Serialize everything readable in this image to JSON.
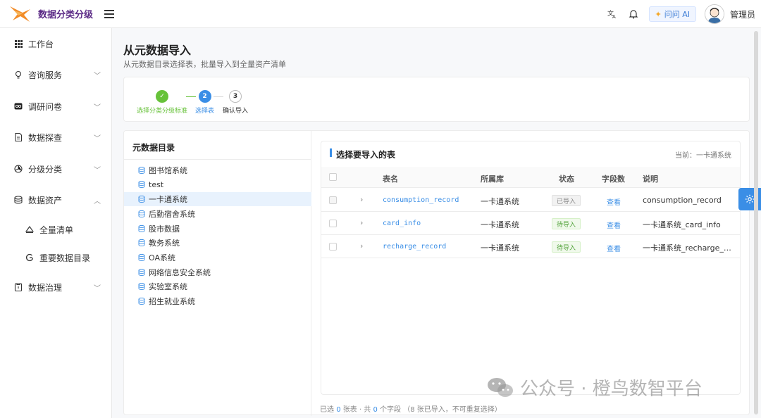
{
  "app": {
    "title": "数据分类分级"
  },
  "topbar": {
    "ai_label": "问问 AI",
    "user_name": "管理员"
  },
  "sidebar": {
    "items": [
      {
        "label": "工作台"
      },
      {
        "label": "咨询服务"
      },
      {
        "label": "调研问卷"
      },
      {
        "label": "数据探查"
      },
      {
        "label": "分级分类"
      },
      {
        "label": "数据资产"
      },
      {
        "label": "全量清单"
      },
      {
        "label": "重要数据目录"
      },
      {
        "label": "数据治理"
      }
    ]
  },
  "page": {
    "title": "从元数据导入",
    "subtitle": "从元数据目录选择表，批量导入到全量资产清单"
  },
  "steps": [
    {
      "label": "选择分类分级标准",
      "number": "✓",
      "state": "done"
    },
    {
      "label": "选择表",
      "number": "2",
      "state": "active"
    },
    {
      "label": "确认导入",
      "number": "3",
      "state": "pending"
    }
  ],
  "catalog": {
    "title": "元数据目录",
    "items": [
      {
        "label": "图书馆系统"
      },
      {
        "label": "test"
      },
      {
        "label": "一卡通系统"
      },
      {
        "label": "后勤宿舍系统"
      },
      {
        "label": "股市数据"
      },
      {
        "label": "教务系统"
      },
      {
        "label": "OA系统"
      },
      {
        "label": "网络信息安全系统"
      },
      {
        "label": "实验室系统"
      },
      {
        "label": "招生就业系统"
      }
    ],
    "selected_index": 2
  },
  "tables": {
    "title": "选择要导入的表",
    "current_label": "当前：一卡通系统",
    "columns": [
      "表名",
      "所属库",
      "状态",
      "字段数",
      "说明"
    ],
    "rows": [
      {
        "name": "consumption_record",
        "db": "一卡通系统",
        "status": "已导入",
        "fields": "查看",
        "desc": "consumption_record"
      },
      {
        "name": "card_info",
        "db": "一卡通系统",
        "status": "待导入",
        "fields": "查看",
        "desc": "一卡通系统_card_info"
      },
      {
        "name": "recharge_record",
        "db": "一卡通系统",
        "status": "待导入",
        "fields": "查看",
        "desc": "一卡通系统_recharge_…"
      }
    ]
  },
  "footer": {
    "selected_prefix": "已选",
    "selected_count": "0",
    "tables_unit": "张表 · 共",
    "fields_count": "0",
    "fields_unit": "个字段",
    "note": "（8 张已导入，不可重复选择）"
  },
  "watermark": {
    "text": "公众号 · 橙鸟数智平台"
  },
  "colors": {
    "primary": "#3a8ee6",
    "success": "#67c23a",
    "brand": "#5b2a86"
  }
}
